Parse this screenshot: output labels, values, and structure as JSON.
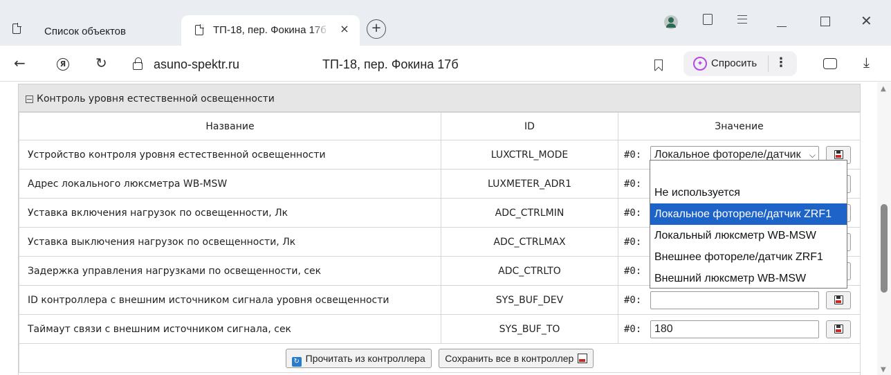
{
  "browser": {
    "tabs": [
      {
        "label": "Список объектов",
        "active": false
      },
      {
        "label": "ТП-18, пер. Фокина 17б",
        "active": true
      }
    ],
    "new_tab_symbol": "+",
    "close_symbol": "×",
    "address": {
      "domain": "asuno-spektr.ru",
      "page_title": "ТП-18, пер. Фокина 17б"
    },
    "ask_button": "Спросить",
    "window_controls": {
      "minimize": "—",
      "maximize": "☐",
      "close": "✕"
    }
  },
  "panel": {
    "title": "Контроль уровня естественной освещенности",
    "columns": {
      "name": "Название",
      "id": "ID",
      "value": "Значение"
    },
    "index_prefix": "#0:",
    "rows": [
      {
        "name": "Устройство контроля уровня естественной освещенности",
        "id": "LUXCTRL_MODE",
        "value": "Локальное фотореле/датчик ZRF1",
        "type": "select"
      },
      {
        "name": "Адрес локального люксметра WB-MSW",
        "id": "LUXMETER_ADR1",
        "value": "",
        "type": "input"
      },
      {
        "name": "Уставка включения нагрузок по освещенности, Лк",
        "id": "ADC_CTRLMIN",
        "value": "",
        "type": "input"
      },
      {
        "name": "Уставка выключения нагрузок по освещенности, Лк",
        "id": "ADC_CTRLMAX",
        "value": "",
        "type": "input"
      },
      {
        "name": "Задержка управления нагрузками по освещенности, сек",
        "id": "ADC_CTRLTO",
        "value": "",
        "type": "input"
      },
      {
        "name": "ID контроллера с внешним источником сигнала уровня освещенности",
        "id": "SYS_BUF_DEV",
        "value": "",
        "type": "input"
      },
      {
        "name": "Таймаут связи с внешним источником сигнала, сек",
        "id": "SYS_BUF_TO",
        "value": "180",
        "type": "input"
      }
    ],
    "actions": {
      "read": "Прочитать из контроллера",
      "save_all": "Сохранить все в контроллер"
    }
  },
  "dropdown": {
    "options": [
      {
        "label": "",
        "selected": false
      },
      {
        "label": "Не используется",
        "selected": false
      },
      {
        "label": "Локальное фотореле/датчик ZRF1",
        "selected": true
      },
      {
        "label": "Локальный люксметр WB-MSW",
        "selected": false
      },
      {
        "label": "Внешнее фотореле/датчик ZRF1",
        "selected": false
      },
      {
        "label": "Внешний люксметр WB-MSW",
        "selected": false
      }
    ]
  },
  "colors": {
    "selected_option": "#1e64c8",
    "header_bg": "#e6e6e6",
    "ask_icon": "#b845e6",
    "refresh_icon": "#2a7cc7"
  }
}
